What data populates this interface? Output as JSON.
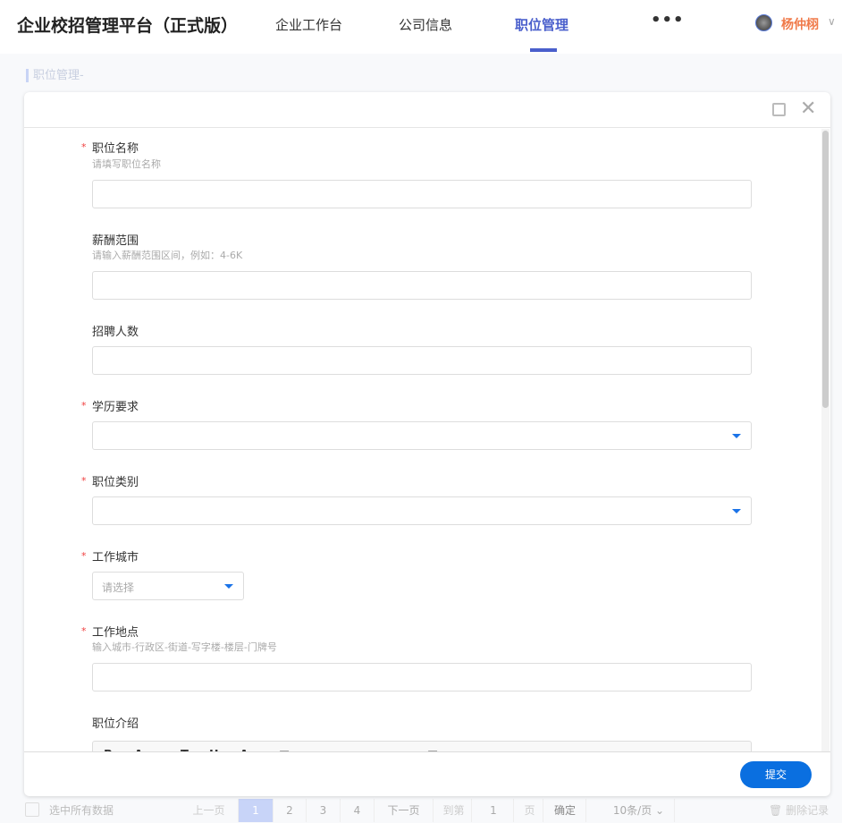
{
  "header": {
    "title": "企业校招管理平台（正式版）",
    "nav": [
      "企业工作台",
      "公司信息",
      "职位管理"
    ],
    "more": "•••",
    "user": "杨仲栩"
  },
  "breadcrumb": "职位管理-",
  "form": {
    "name": {
      "label": "职位名称",
      "hint": "请填写职位名称"
    },
    "salary": {
      "label": "薪酬范围",
      "hint": "请输入薪酬范围区间，例如：4-6K"
    },
    "count": {
      "label": "招聘人数"
    },
    "edu": {
      "label": "学历要求"
    },
    "category": {
      "label": "职位类别"
    },
    "city": {
      "label": "工作城市",
      "placeholder": "请选择"
    },
    "address": {
      "label": "工作地点",
      "hint": "输入城市-行政区-街道-写字楼-楼层-门牌号"
    },
    "intro": {
      "label": "职位介绍"
    },
    "required_mark": "*"
  },
  "submit": "提交",
  "pagination": {
    "select_all": "选中所有数据",
    "prev": "上一页",
    "pages": [
      "1",
      "2",
      "3",
      "4"
    ],
    "next": "下一页",
    "goto": "到第",
    "page_input": "1",
    "page_unit": "页",
    "confirm": "确定",
    "page_size": "10条/页",
    "delete": "删除记录"
  }
}
